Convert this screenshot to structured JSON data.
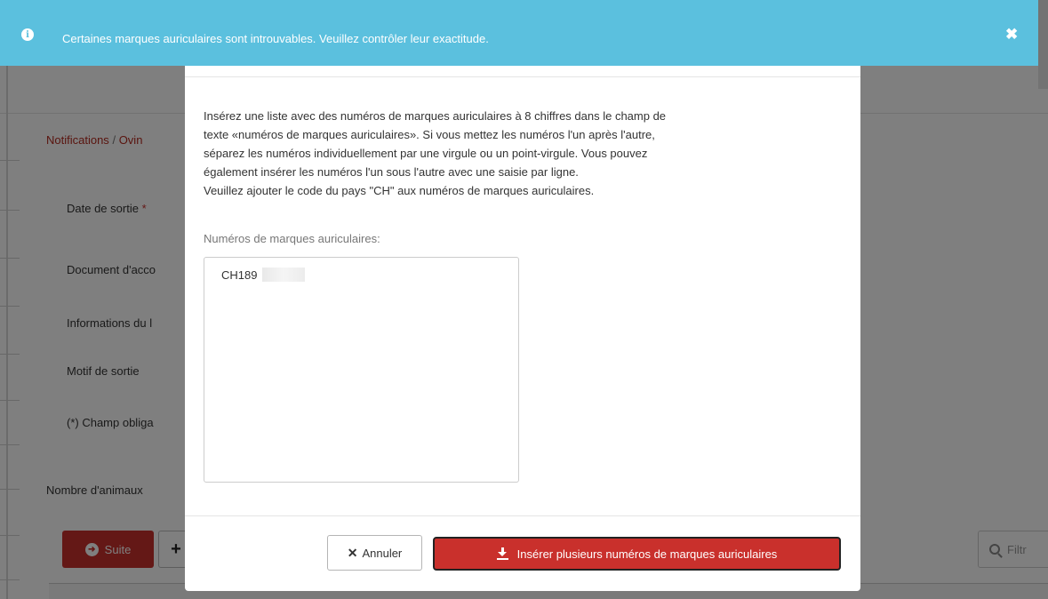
{
  "alert": {
    "message": "Certaines marques auriculaires sont introuvables. Veuillez contrôler leur exactitude.",
    "icon": "info-circle-icon",
    "close_icon": "close-icon",
    "color": "#5bc0de"
  },
  "background": {
    "breadcrumb": {
      "first": "Notifications",
      "separator": "/",
      "second": "Ovin"
    },
    "labels": {
      "date_de_sortie": "Date de sortie",
      "required_marker": "*",
      "document": "Document d'acco",
      "informations": "Informations du l",
      "motif": "Motif de sortie",
      "champ_obligatoire": "(*) Champ obliga"
    },
    "count_label": "Nombre d'animaux",
    "suite_button": "Suite",
    "plus_button": "+",
    "filter_placeholder": "Filtr"
  },
  "modal": {
    "description_lines": [
      "Insérez une liste avec des numéros de marques auriculaires à 8 chiffres dans le champ de",
      "texte «numéros de marques auriculaires». Si vous mettez les numéros l'un après l'autre,",
      "séparez les numéros individuellement par une virgule ou un point-virgule. Vous pouvez",
      "également insérer les numéros l'un sous l'autre avec une saisie par ligne.",
      "Veuillez ajouter le code du pays \"CH\" aux numéros de marques auriculaires."
    ],
    "field_label": "Numéros de marques auriculaires:",
    "textarea_value": "CH189",
    "cancel_label": "Annuler",
    "insert_label": "Insérer plusieurs numéros de marques auriculaires",
    "accent_color": "#c9302c"
  }
}
